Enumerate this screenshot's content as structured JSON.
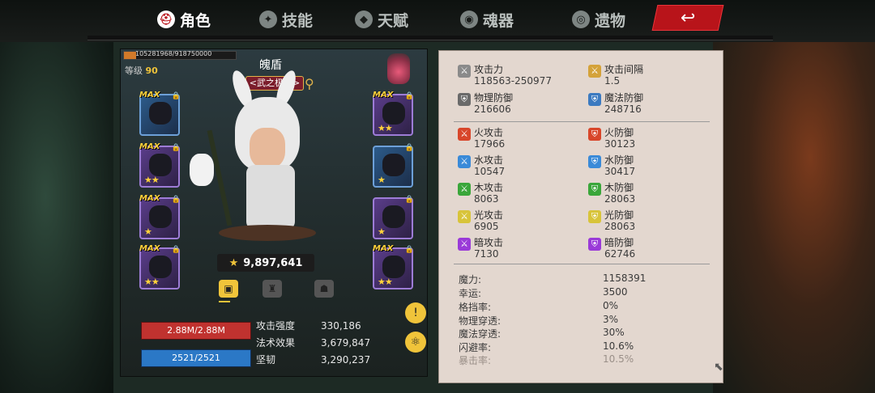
{
  "tabs": [
    {
      "label": "角色",
      "icon": "helmet-icon",
      "active": true
    },
    {
      "label": "技能",
      "icon": "skill-icon",
      "active": false
    },
    {
      "label": "天赋",
      "icon": "talent-icon",
      "active": false
    },
    {
      "label": "魂器",
      "icon": "soul-icon",
      "active": false
    },
    {
      "label": "遗物",
      "icon": "relic-icon",
      "active": false
    }
  ],
  "back_icon": "back-arrow-icon",
  "character": {
    "xp": "105281968/918750000",
    "xp_fraction": 0.11,
    "level_label": "等级",
    "level": "90",
    "name": "魄盾",
    "title": "<武之极致>",
    "power": "9,897,641"
  },
  "equipment": {
    "left": [
      {
        "max": "MAX",
        "stars": "",
        "color": "blue"
      },
      {
        "max": "MAX",
        "stars": "★★",
        "color": "purple"
      },
      {
        "max": "MAX",
        "stars": "★",
        "color": "purple"
      },
      {
        "max": "MAX",
        "stars": "★★",
        "color": "purple"
      }
    ],
    "right": [
      {
        "max": "MAX",
        "stars": "★★",
        "color": "purple"
      },
      {
        "max": "",
        "stars": "★",
        "color": "blue"
      },
      {
        "max": "",
        "stars": "★",
        "color": "purple"
      },
      {
        "max": "MAX",
        "stars": "★★",
        "color": "purple"
      }
    ]
  },
  "bars": {
    "hp": "2.88M/2.88M",
    "mp": "2521/2521"
  },
  "minor_stats": [
    {
      "label": "攻击强度",
      "value": "330,186"
    },
    {
      "label": "法术效果",
      "value": "3,679,847"
    },
    {
      "label": "坚韧",
      "value": "3,290,237"
    }
  ],
  "stats": {
    "basic": [
      {
        "label": "攻击力",
        "value": "118563-250977",
        "icon": "sword-icon",
        "color": "#8a8a8a"
      },
      {
        "label": "攻击间隔",
        "value": "1.5",
        "icon": "sword-gold-icon",
        "color": "#d4a23a"
      },
      {
        "label": "物理防御",
        "value": "216606",
        "icon": "sword-shield-icon",
        "color": "#6a6a6a"
      },
      {
        "label": "魔法防御",
        "value": "248716",
        "icon": "magic-shield-icon",
        "color": "#3c7ac0"
      }
    ],
    "elements": [
      {
        "label": "火攻击",
        "value": "17966",
        "icon": "fire-attack-icon",
        "color": "#d8462a"
      },
      {
        "label": "火防御",
        "value": "30123",
        "icon": "fire-defense-icon",
        "color": "#d8462a"
      },
      {
        "label": "水攻击",
        "value": "10547",
        "icon": "water-attack-icon",
        "color": "#3a8ad8"
      },
      {
        "label": "水防御",
        "value": "30417",
        "icon": "water-defense-icon",
        "color": "#3a8ad8"
      },
      {
        "label": "木攻击",
        "value": "8063",
        "icon": "wood-attack-icon",
        "color": "#3aa63a"
      },
      {
        "label": "木防御",
        "value": "28063",
        "icon": "wood-defense-icon",
        "color": "#3aa63a"
      },
      {
        "label": "光攻击",
        "value": "6905",
        "icon": "light-attack-icon",
        "color": "#d8c43a"
      },
      {
        "label": "光防御",
        "value": "28063",
        "icon": "light-defense-icon",
        "color": "#d8c43a"
      },
      {
        "label": "暗攻击",
        "value": "7130",
        "icon": "dark-attack-icon",
        "color": "#9a3ad8"
      },
      {
        "label": "暗防御",
        "value": "62746",
        "icon": "dark-defense-icon",
        "color": "#9a3ad8"
      }
    ],
    "misc": [
      {
        "label": "魔力:",
        "value": "1158391"
      },
      {
        "label": "幸运:",
        "value": "3500"
      },
      {
        "label": "格挡率:",
        "value": "0%"
      },
      {
        "label": "物理穿透:",
        "value": "3%"
      },
      {
        "label": "魔法穿透:",
        "value": "30%"
      },
      {
        "label": "闪避率:",
        "value": "10.6%"
      },
      {
        "label": "暴击率:",
        "value": "10.5%"
      }
    ]
  }
}
